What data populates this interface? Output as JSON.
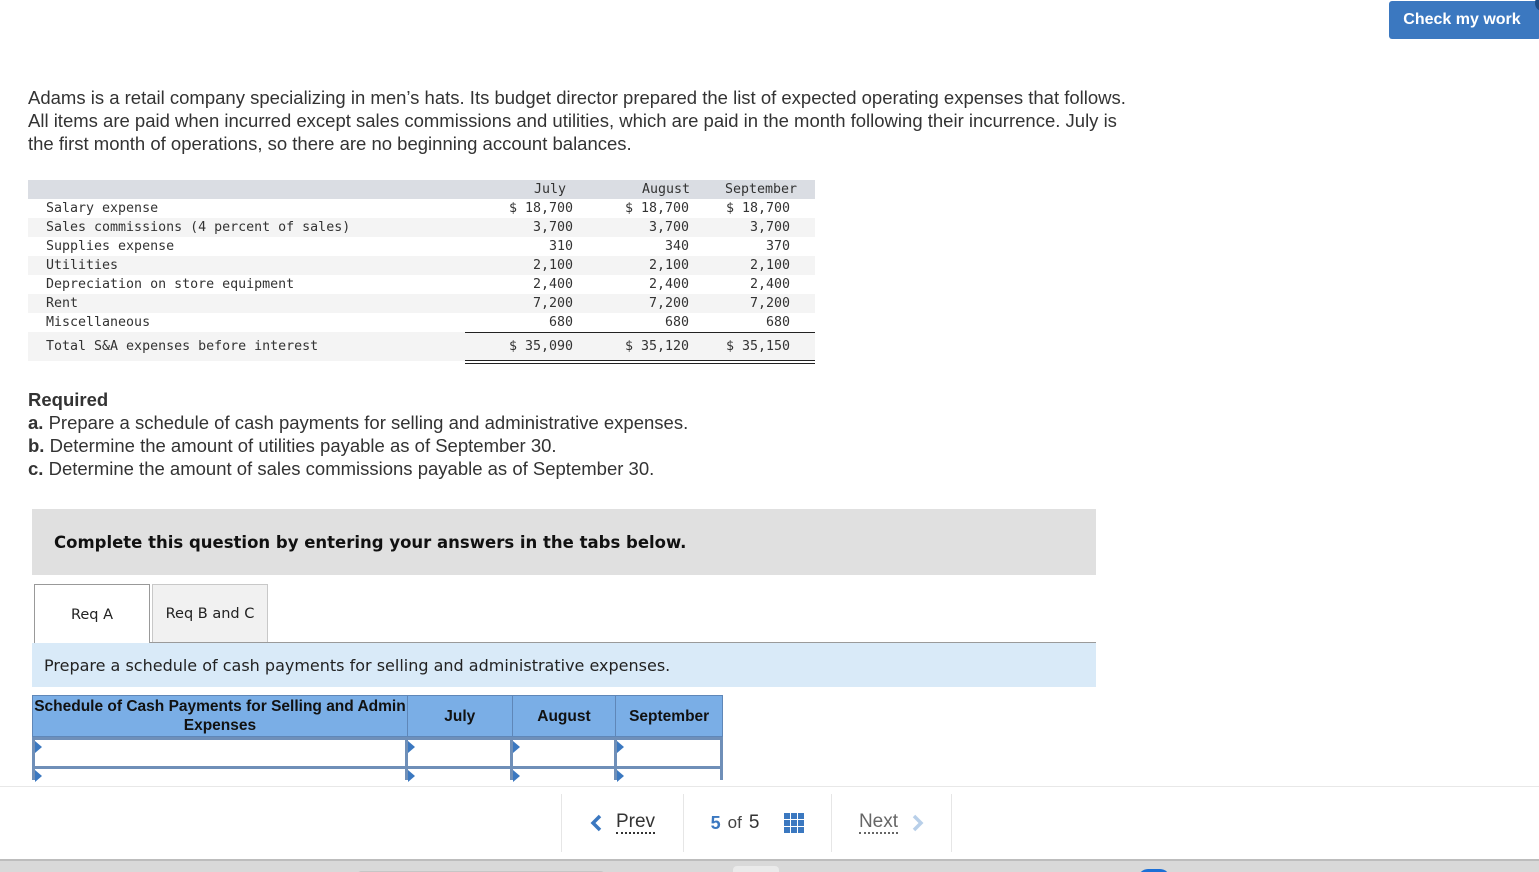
{
  "header": {
    "check_button": "Check my work"
  },
  "intro": {
    "lines": [
      "Adams is a retail company specializing in men’s hats. Its budget director prepared the list of expected operating expenses that follows.",
      "All items are paid when incurred except sales commissions and utilities, which are paid in the month following their incurrence. July is",
      "the first month of operations, so there are no beginning account balances."
    ]
  },
  "expense_table": {
    "columns": [
      "July",
      "August",
      "September"
    ],
    "rows": [
      {
        "label": "Salary expense",
        "values": [
          "$ 18,700",
          "$ 18,700",
          "$ 18,700"
        ]
      },
      {
        "label": "Sales commissions (4 percent of sales)",
        "values": [
          "3,700",
          "3,700",
          "3,700"
        ]
      },
      {
        "label": "Supplies expense",
        "values": [
          "310",
          "340",
          "370"
        ]
      },
      {
        "label": "Utilities",
        "values": [
          "2,100",
          "2,100",
          "2,100"
        ]
      },
      {
        "label": "Depreciation on store equipment",
        "values": [
          "2,400",
          "2,400",
          "2,400"
        ]
      },
      {
        "label": "Rent",
        "values": [
          "7,200",
          "7,200",
          "7,200"
        ]
      },
      {
        "label": "Miscellaneous",
        "values": [
          "680",
          "680",
          "680"
        ]
      }
    ],
    "total": {
      "label": "Total S&A expenses before interest",
      "values": [
        "$ 35,090",
        "$ 35,120",
        "$ 35,150"
      ]
    }
  },
  "required": {
    "title": "Required",
    "items": [
      {
        "letter": "a.",
        "text": " Prepare a schedule of cash payments for selling and administrative expenses."
      },
      {
        "letter": "b.",
        "text": " Determine the amount of utilities payable as of September 30."
      },
      {
        "letter": "c.",
        "text": " Determine the amount of sales commissions payable as of September 30."
      }
    ]
  },
  "instructions_box": "Complete this question by entering your answers in the tabs below.",
  "tabs": [
    {
      "label": "Req A",
      "active": true
    },
    {
      "label": "Req B and C",
      "active": false
    }
  ],
  "tab_instruction": "Prepare a schedule of cash payments for selling and administrative expenses.",
  "schedule": {
    "headers": [
      "Schedule of Cash Payments for Selling and Admin Expenses",
      "July",
      "August",
      "September"
    ],
    "rows": [
      [
        "",
        "",
        "",
        ""
      ],
      [
        "",
        "",
        "",
        ""
      ]
    ]
  },
  "pager": {
    "prev": "Prev",
    "current": "5",
    "of": "of",
    "total": "5",
    "next": "Next"
  },
  "colors": {
    "accent": "#3b78c0",
    "schedule_header": "#7aaee6",
    "instruction_bg": "#d9eaf8",
    "complete_box_bg": "#e0e0e0"
  }
}
